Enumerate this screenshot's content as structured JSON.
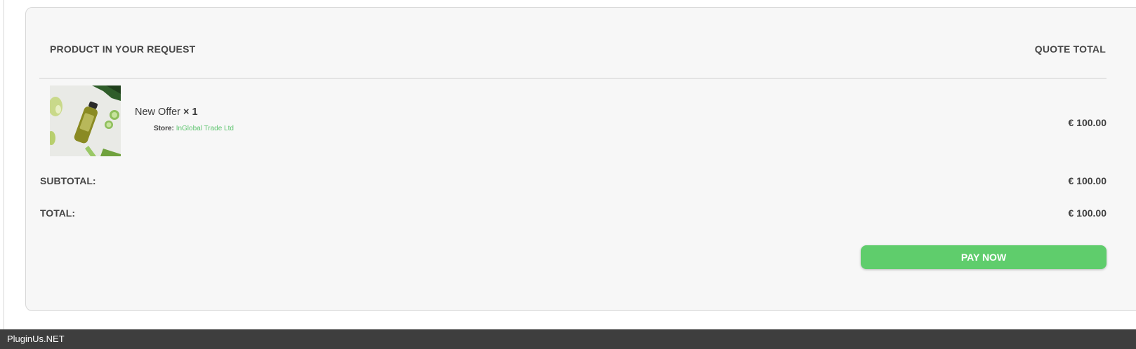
{
  "quote": {
    "header_product": "PRODUCT IN YOUR REQUEST",
    "header_total": "QUOTE TOTAL",
    "item": {
      "name": "New Offer",
      "qty": "× 1",
      "store_label": "Store:",
      "store_name": "InGlobal Trade Ltd",
      "price": "€ 100.00"
    },
    "subtotal_label": "SUBTOTAL:",
    "subtotal_value": "€ 100.00",
    "total_label": "TOTAL:",
    "total_value": "€ 100.00",
    "pay_label": "PAY NOW"
  },
  "footer": {
    "text": "PluginUs.NET"
  },
  "colors": {
    "accent": "#5fcd6c",
    "store_link": "#5fc570",
    "footer_bg": "#3e3e3e"
  }
}
